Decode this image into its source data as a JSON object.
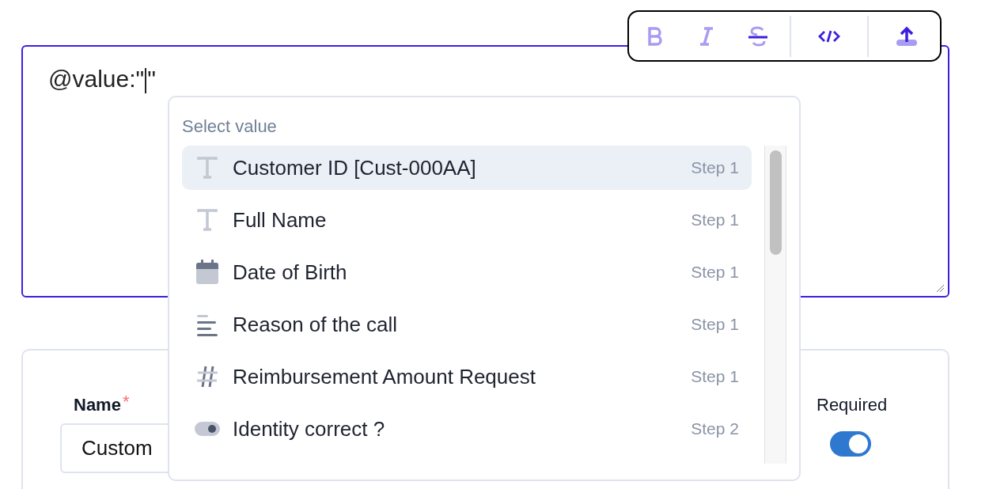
{
  "editor": {
    "value": "@value:\"\""
  },
  "dropdown": {
    "heading": "Select value",
    "items": [
      {
        "kind": "text",
        "label": "Customer ID [Cust-000AA]",
        "step": "Step 1",
        "selected": true
      },
      {
        "kind": "text",
        "label": "Full Name",
        "step": "Step 1",
        "selected": false
      },
      {
        "kind": "date",
        "label": "Date of Birth",
        "step": "Step 1",
        "selected": false
      },
      {
        "kind": "paragraph",
        "label": "Reason of the call",
        "step": "Step 1",
        "selected": false
      },
      {
        "kind": "number",
        "label": "Reimbursement Amount Request",
        "step": "Step 1",
        "selected": false
      },
      {
        "kind": "boolean",
        "label": "Identity correct ?",
        "step": "Step 2",
        "selected": false
      }
    ]
  },
  "field_settings": {
    "name_label": "Name",
    "required_mark": "*",
    "name_value": "Custom",
    "required_label": "Required",
    "required": {
      "on": true
    }
  }
}
